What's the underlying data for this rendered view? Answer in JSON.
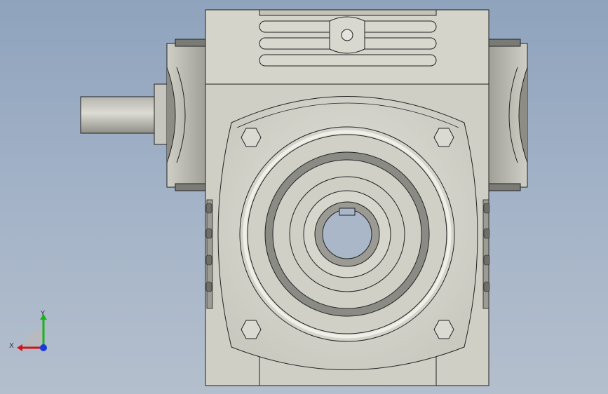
{
  "viewport": {
    "background_top": "#8fa3bd",
    "background_bottom": "#b4bfcd",
    "model_fill": "#d8d8cf",
    "model_shadow": "#a8a8a0",
    "model_dark": "#6f6f6a",
    "outline": "#222222"
  },
  "triad": {
    "x_label": "X",
    "y_label": "Y",
    "x_color": "#d21414",
    "y_color": "#19b419",
    "z_color": "#1a3ad8"
  }
}
